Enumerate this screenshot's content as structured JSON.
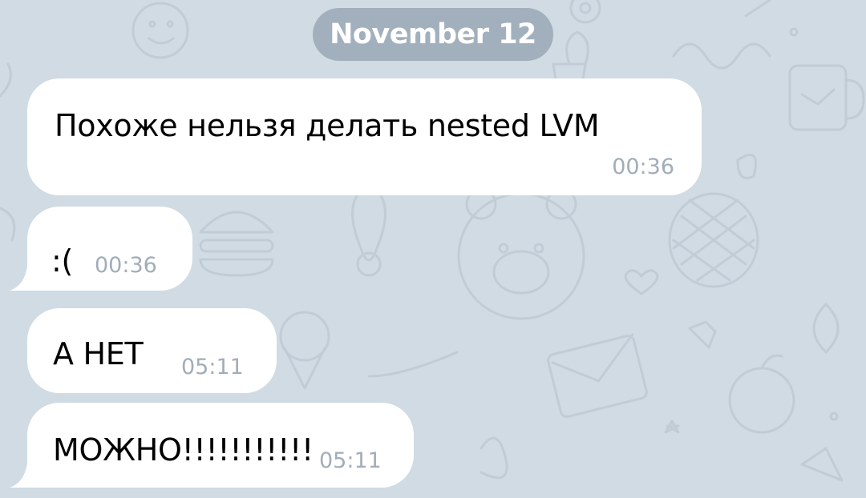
{
  "chat": {
    "date_label": "November 12",
    "background_color": "#d1dbe3",
    "bubble_color": "#ffffff",
    "time_color": "#a2adb8",
    "messages": [
      {
        "text": "Похоже нельзя делать nested LVM",
        "time": "00:36"
      },
      {
        "text": ":(",
        "time": "00:36"
      },
      {
        "text": "А НЕТ",
        "time": "05:11"
      },
      {
        "text": "МОЖНО!!!!!!!!!!!",
        "time": "05:11"
      }
    ]
  }
}
